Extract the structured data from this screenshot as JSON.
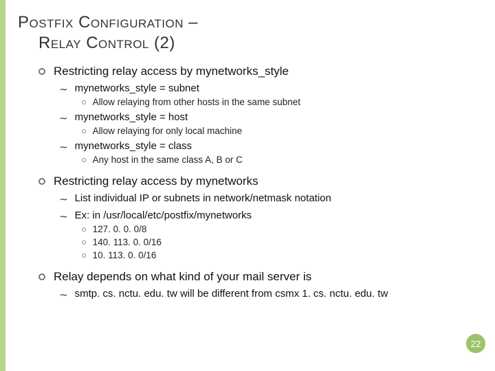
{
  "title_line1": "Postfix Configuration –",
  "title_line2": "Relay Control (2)",
  "sections": [
    {
      "text": "Restricting relay access by mynetworks_style",
      "items": [
        {
          "text": "mynetworks_style = subnet",
          "sub": [
            {
              "text": "Allow relaying from other hosts in the same subnet"
            }
          ]
        },
        {
          "text": "mynetworks_style = host",
          "sub": [
            {
              "text": "Allow relaying for only local machine"
            }
          ]
        },
        {
          "text": "mynetworks_style = class",
          "sub": [
            {
              "text": "Any host in the same class A, B or C"
            }
          ]
        }
      ]
    },
    {
      "text": "Restricting relay access by mynetworks",
      "items": [
        {
          "text": "List individual IP or subnets in network/netmask notation",
          "sub": []
        },
        {
          "text": "Ex: in /usr/local/etc/postfix/mynetworks",
          "sub": [
            {
              "text": "127. 0. 0. 0/8"
            },
            {
              "text": "140. 113. 0. 0/16"
            },
            {
              "text": "10. 113. 0. 0/16"
            }
          ]
        }
      ]
    },
    {
      "text": "Relay depends on what kind of your mail server is",
      "items": [
        {
          "text": "smtp. cs. nctu. edu. tw will be different from csmx 1. cs. nctu. edu. tw",
          "sub": []
        }
      ]
    }
  ],
  "page_number": "22"
}
